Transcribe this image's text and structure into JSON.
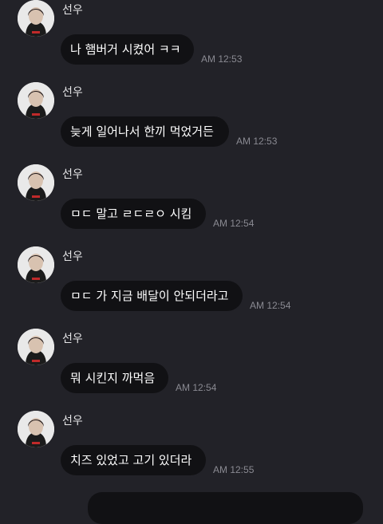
{
  "sender_name": "선우",
  "messages": [
    {
      "text": "나 햄버거 시켰어 ㅋㅋ",
      "time": "AM 12:53"
    },
    {
      "text": "늦게 일어나서 한끼 먹었거든",
      "time": "AM 12:53"
    },
    {
      "text": "ㅁㄷ 말고 ㄹㄷㄹㅇ 시킴",
      "time": "AM 12:54"
    },
    {
      "text": "ㅁㄷ 가 지금 배달이 안되더라고",
      "time": "AM 12:54"
    },
    {
      "text": "뭐 시킨지 까먹음",
      "time": "AM 12:54"
    },
    {
      "text": "치즈 있었고 고기 있더라",
      "time": "AM 12:55"
    }
  ],
  "colors": {
    "background": "#222228",
    "bubble": "#111114",
    "text": "#ffffff",
    "timestamp": "#8a8a92"
  }
}
